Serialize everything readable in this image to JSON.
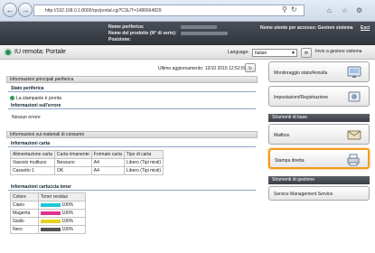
{
  "browser": {
    "url": "http://192.168.0.1:8000/rps/portal.cgi?CSUT=1486664829",
    "search_icon": "magnifier-icon"
  },
  "header": {
    "device_name_label": "Nome periferica:",
    "product_name_label": "Nome del prodotto (N° di serie):",
    "location_label": "Posizione:",
    "login_info": "Nome utente per accesso: Gestore sistema",
    "logout": "Esci"
  },
  "titlebar": {
    "title": "IU remota: Portale",
    "language_label": "Language:",
    "language_value": "Italian",
    "mail_button": "✉",
    "admin_link": "Invio a gestore sistema"
  },
  "main": {
    "last_update": "Ultimo aggiornamento: 12/10 2015 12:52:59",
    "refresh_icon": "refresh-icon",
    "info_section": "Informazioni principali periferica",
    "status_heading": "Stato periferica",
    "status_text": "La stampante è pronta",
    "error_heading": "Informazioni sull'errore",
    "error_text": "Nessun errore",
    "consumables_section": "Informazioni sui materiali di consumo",
    "paper_heading": "Informazioni carta",
    "paper_table": {
      "headers": [
        "Alimentazione carta",
        "Carta rimanente",
        "Formato carta",
        "Tipo di carta"
      ],
      "rows": [
        [
          "Vassoio multiuso",
          "Nessuno",
          "A4",
          "Libero (Tipi misti)"
        ],
        [
          "Cassetto 1",
          "OK",
          "A4",
          "Libero (Tipi misti)"
        ]
      ]
    },
    "toner_heading": "Informazioni cartuccia toner",
    "toner_table": {
      "headers": [
        "Colore",
        "Toner residuo"
      ],
      "rows": [
        {
          "color": "Ciano",
          "value": "100%",
          "swatch": "#1ec8d8",
          "level": 1.0
        },
        {
          "color": "Magenta",
          "value": "100%",
          "swatch": "#e0338f",
          "level": 1.0
        },
        {
          "color": "Giallo",
          "value": "100%",
          "swatch": "#e5d21f",
          "level": 1.0
        },
        {
          "color": "Nero",
          "value": "100%",
          "swatch": "#555555",
          "level": 1.0
        }
      ]
    }
  },
  "sidebar": {
    "monitoring_button": "Monitoraggio stato/Annulla",
    "settings_button": "Impostazioni/Registrazione",
    "basic_tools_heading": "Strumenti di base",
    "mailbox_button": "Mailbox",
    "direct_print_button": "Stampa diretta",
    "management_tools_heading": "Strumenti di gestione",
    "service_button": "Service Management Service"
  }
}
